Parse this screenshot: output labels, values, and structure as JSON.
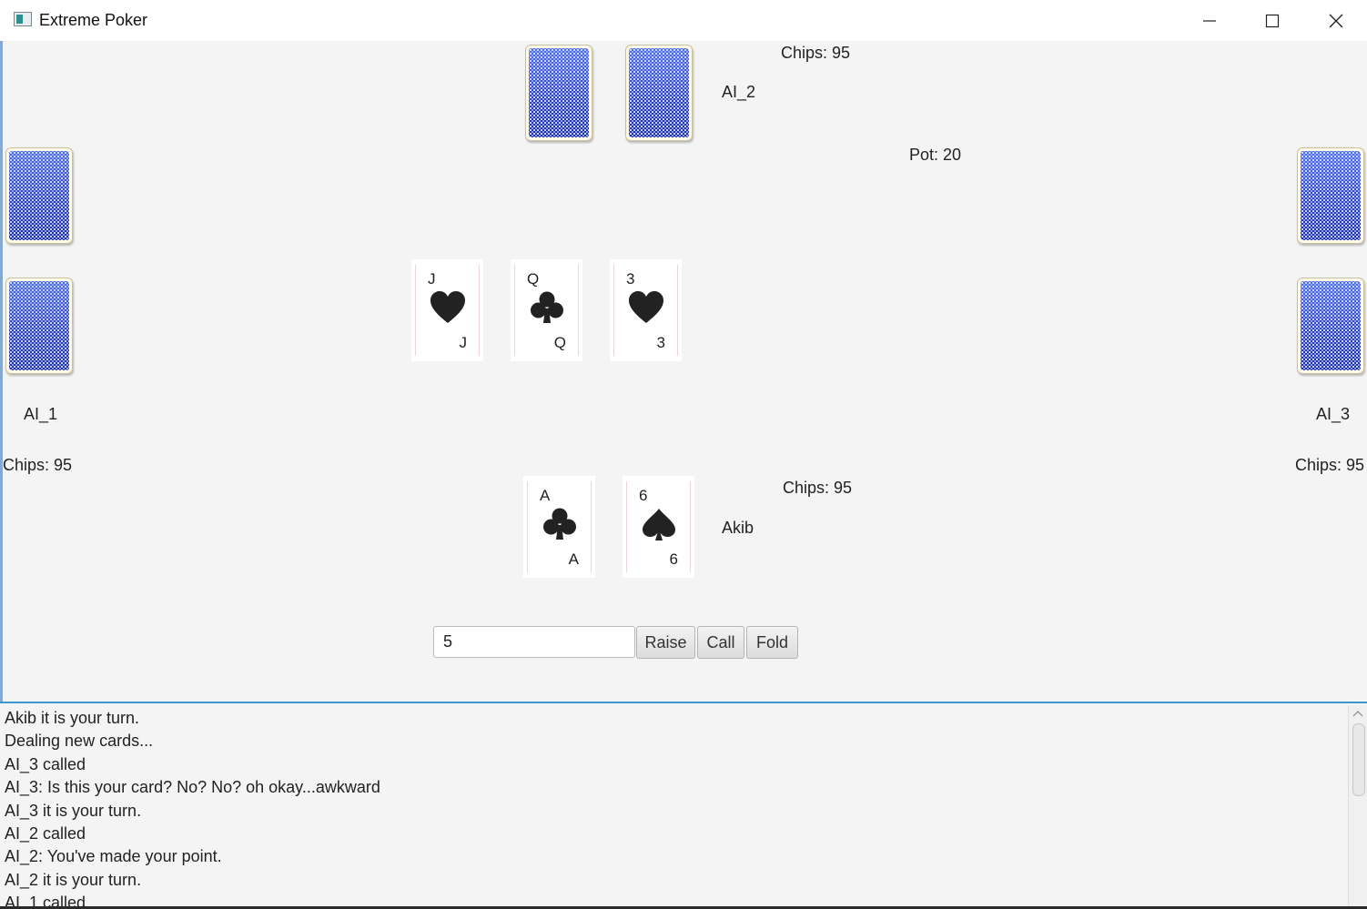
{
  "window": {
    "title": "Extreme Poker",
    "controls": [
      "minimize-icon",
      "maximize-icon",
      "close-icon"
    ]
  },
  "table": {
    "pot_label": "Pot: 20",
    "community_cards": [
      {
        "rank": "J",
        "suit": "heart"
      },
      {
        "rank": "Q",
        "suit": "club"
      },
      {
        "rank": "3",
        "suit": "heart"
      }
    ]
  },
  "players": {
    "top": {
      "name": "AI_2",
      "chips": "Chips: 95"
    },
    "left": {
      "name": "AI_1",
      "chips": "Chips: 95"
    },
    "right": {
      "name": "AI_3",
      "chips": "Chips: 95"
    },
    "bottom": {
      "name": "Akib",
      "chips": "Chips: 95",
      "cards": [
        {
          "rank": "A",
          "suit": "club"
        },
        {
          "rank": "6",
          "suit": "spade"
        }
      ]
    }
  },
  "controls": {
    "bet_value": "5",
    "raise_label": "Raise",
    "call_label": "Call",
    "fold_label": "Fold"
  },
  "log": [
    "Akib it is your turn.",
    "Dealing new cards...",
    "AI_3 called",
    "AI_3: Is this your card? No? No? oh okay...awkward",
    "AI_3 it is your turn.",
    "AI_2 called",
    "AI_2: You've made your point.",
    "AI_2 it is your turn.",
    "AI_1 called"
  ],
  "colors": {
    "card_back": "#3a55d6",
    "log_border": "#3b95cf",
    "background": "#f4f4f4"
  }
}
